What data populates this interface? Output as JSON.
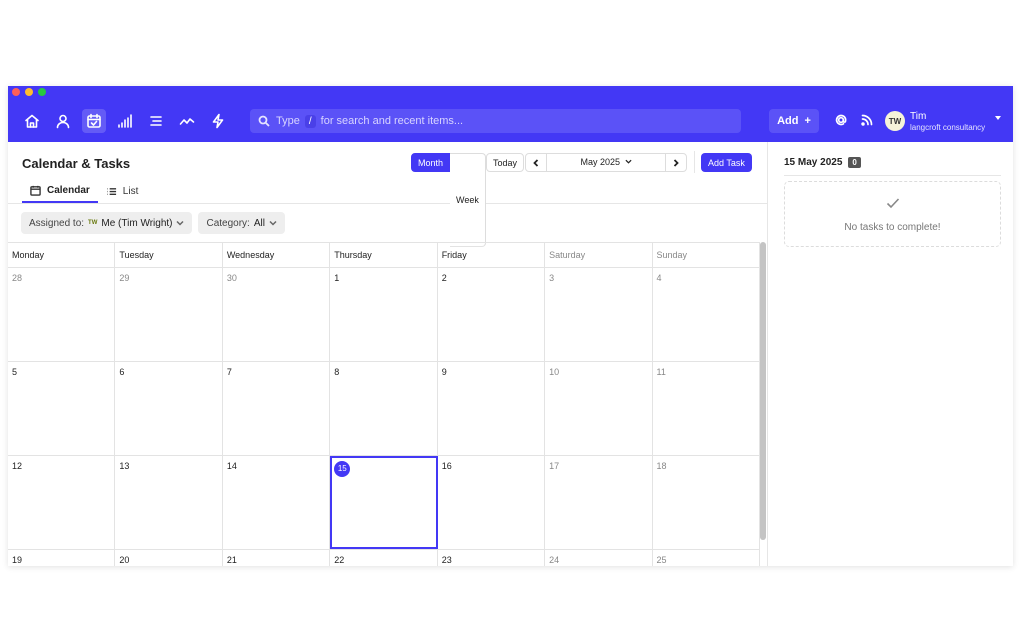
{
  "search": {
    "prefix": "Type",
    "key": "/",
    "suffix": "for search and recent items..."
  },
  "toolbar": {
    "add_label": "Add",
    "add_icon": "+"
  },
  "user": {
    "initials": "TW",
    "name": "Tim",
    "org": "langcroft consultancy"
  },
  "page": {
    "title": "Calendar & Tasks"
  },
  "tabs": [
    {
      "label": "Calendar"
    },
    {
      "label": "List"
    }
  ],
  "view": {
    "month": "Month",
    "week": "Week",
    "today": "Today",
    "current": "May 2025",
    "add_task": "Add Task"
  },
  "filters": {
    "assigned_label": "Assigned to:",
    "assigned_tag": "TW",
    "assigned_value": "Me (Tim Wright)",
    "category_label": "Category:",
    "category_value": "All"
  },
  "calendar": {
    "weekdays": [
      "Monday",
      "Tuesday",
      "Wednesday",
      "Thursday",
      "Friday",
      "Saturday",
      "Sunday"
    ],
    "weeks": [
      [
        "28",
        "29",
        "30",
        "1",
        "2",
        "3",
        "4"
      ],
      [
        "5",
        "6",
        "7",
        "8",
        "9",
        "10",
        "11"
      ],
      [
        "12",
        "13",
        "14",
        "15",
        "16",
        "17",
        "18"
      ],
      [
        "19",
        "20",
        "21",
        "22",
        "23",
        "24",
        "25"
      ]
    ]
  },
  "side": {
    "date": "15 May 2025",
    "count": "0",
    "empty_message": "No tasks to complete!"
  }
}
